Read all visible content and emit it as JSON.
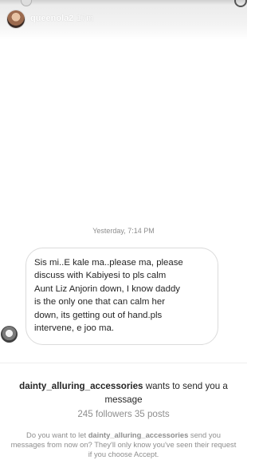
{
  "header": {
    "username": "queenola2",
    "time_ago": "17m"
  },
  "thread": {
    "timestamp": "Yesterday, 7:14 PM",
    "message": "Sis mi..E kale ma..please ma, please\ndiscuss with Kabiyesi to pls calm\nAunt Liz Anjorin down, I know daddy\nis the only one that can calm her\ndown, its getting out of hand.pls\nintervene, e joo ma."
  },
  "request": {
    "sender": "dainty_alluring_accessories",
    "title_rest": " wants to send you a message",
    "followers": "245 followers",
    "posts": "35 posts",
    "prompt_prefix": "Do you want to let ",
    "prompt_sender": "dainty_alluring_accessories",
    "prompt_suffix": " send you messages from now on? They'll only know you've seen their request if you choose Accept."
  },
  "colors": {
    "text_primary": "#262626",
    "text_secondary": "#8e8e8e",
    "bubble_border": "#dbdbdb"
  }
}
